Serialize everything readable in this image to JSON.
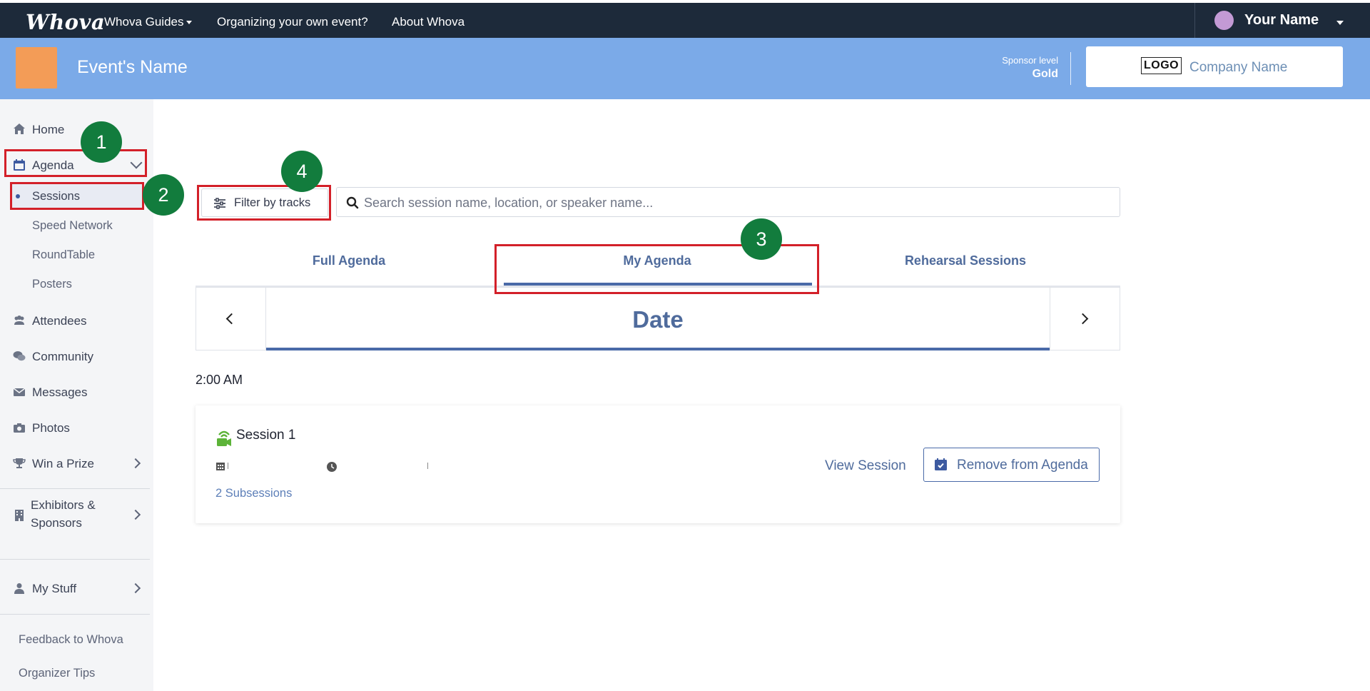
{
  "topnav": {
    "logo": "Whova",
    "links": [
      "Whova Guides",
      "Organizing your own event?",
      "About Whova"
    ],
    "user_name": "Your Name"
  },
  "event": {
    "name": "Event's Name",
    "sponsor_label": "Sponsor level",
    "sponsor_level": "Gold",
    "company_logo": "LOGO",
    "company_name": "Company Name"
  },
  "sidebar": {
    "home": "Home",
    "agenda": "Agenda",
    "agenda_sub": [
      "Sessions",
      "Speed Network",
      "RoundTable",
      "Posters"
    ],
    "attendees": "Attendees",
    "community": "Community",
    "messages": "Messages",
    "photos": "Photos",
    "win_prize": "Win a Prize",
    "exhibitors_line1": "Exhibitors &",
    "exhibitors_line2": "Sponsors",
    "my_stuff": "My Stuff",
    "feedback": "Feedback to Whova",
    "organizer_tips": "Organizer Tips"
  },
  "annotations": [
    "1",
    "2",
    "3",
    "4"
  ],
  "toolbar": {
    "filter_label": "Filter by tracks",
    "search_placeholder": "Search session name, location, or speaker name..."
  },
  "tabs": [
    "Full Agenda",
    "My Agenda",
    "Rehearsal Sessions"
  ],
  "active_tab": "My Agenda",
  "date_label": "Date",
  "time_slot": "2:00 AM",
  "session": {
    "title": "Session 1",
    "subsessions": "2 Subsessions",
    "view_label": "View Session",
    "remove_label": "Remove from Agenda"
  },
  "colors": {
    "topnav_bg": "#1d2a3a",
    "event_bar_bg": "#7baae8",
    "accent": "#4a6aa8",
    "annotation_red": "#d32029",
    "annotation_badge": "#127c3d",
    "event_thumb": "#f39c57"
  }
}
